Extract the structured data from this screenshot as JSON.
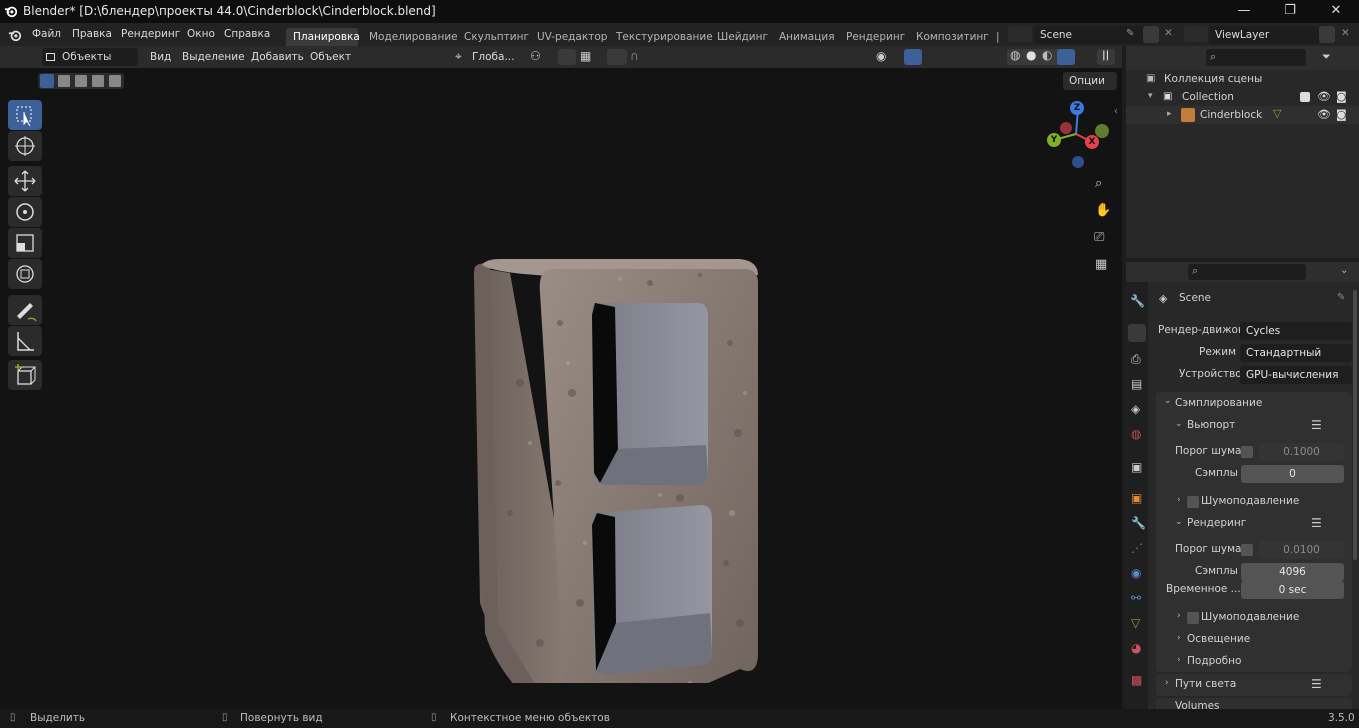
{
  "window": {
    "title": "Blender* [D:\\блендер\\проекты 44.0\\Cinderblock\\Cinderblock.blend]",
    "minimize": "—",
    "maximize": "❐",
    "close": "✕"
  },
  "menu": {
    "items": [
      "Файл",
      "Правка",
      "Рендеринг",
      "Окно",
      "Справка"
    ]
  },
  "workspaces": {
    "tabs": [
      "Планировка",
      "Моделирование",
      "Скульптинг",
      "UV-редактор",
      "Текстурирование",
      "Шейдинг",
      "Анимация",
      "Рендеринг",
      "Композитинг",
      "|"
    ],
    "active": "Планировка"
  },
  "scene_selector": {
    "value": "Scene"
  },
  "viewlayer_selector": {
    "value": "ViewLayer"
  },
  "viewport_header": {
    "mode": "Объекты",
    "menus": [
      "Вид",
      "Выделение",
      "Добавить",
      "Объект"
    ],
    "orientation": "Глоба...",
    "options": "Опции"
  },
  "gizmo": {
    "z": "Z",
    "x": "X",
    "y": "Y"
  },
  "outliner": {
    "root": "Коллекция сцены",
    "collection": "Collection",
    "object": "Cinderblock"
  },
  "properties": {
    "scene_label": "Scene",
    "render_engine_label": "Рендер-движок",
    "render_engine_value": "Cycles",
    "mode_label": "Режим",
    "mode_value": "Стандартный",
    "device_label": "Устройство",
    "device_value": "GPU-вычисления",
    "sampling_panel": "Сэмплирование",
    "viewport_sub": "Вьюпорт",
    "noise_threshold_label": "Порог шума",
    "viewport_noise_value": "0.1000",
    "samples_label": "Сэмплы",
    "viewport_samples_value": "0",
    "denoise_label": "Шумоподавление",
    "render_sub": "Рендеринг",
    "render_noise_value": "0.0100",
    "render_samples_value": "4096",
    "time_limit_label": "Временное ...",
    "time_limit_value": "0 sec",
    "denoise2_label": "Шумоподавление",
    "lights_label": "Освещение",
    "advanced_label": "Подробно",
    "light_paths_panel": "Пути света",
    "volumes_panel": "Volumes"
  },
  "statusbar": {
    "select": "Выделить",
    "rotate": "Повернуть вид",
    "context": "Контекстное меню объектов",
    "version": "3.5.0"
  },
  "colors": {
    "accent_blue": "#3c6198",
    "active_tool": "#3c6198",
    "gizmo_x": "#e0434e",
    "gizmo_y": "#7fb02a",
    "gizmo_z": "#3c7be0"
  }
}
